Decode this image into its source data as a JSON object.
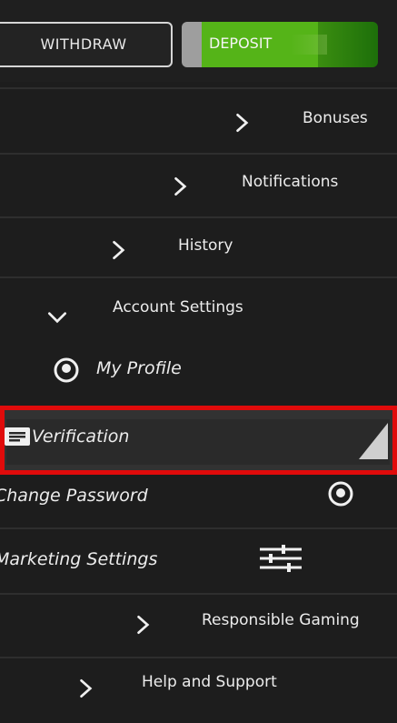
{
  "top": {
    "withdraw_label": "WITHDRAW",
    "deposit_label": "DEPOSIT"
  },
  "menu": {
    "bonuses": "Bonuses",
    "notifications": "Notifications",
    "history": "History",
    "account_settings": "Account Settings",
    "my_profile": "My Profile",
    "verification": "Verification",
    "change_password": "Change Password",
    "marketing_settings": "Marketing Settings",
    "responsible_gaming": "Responsible Gaming",
    "help_support": "Help and Support"
  },
  "colors": {
    "highlight_border": "#e00b0b",
    "deposit_green": "#55b418",
    "background": "#1d1d1d"
  },
  "icons": {
    "chevron": "chevron-right-icon",
    "expanded": "chevron-down-icon",
    "profile": "profile-icon",
    "verification": "id-card-icon",
    "password": "lock-icon",
    "marketing": "sliders-icon"
  }
}
